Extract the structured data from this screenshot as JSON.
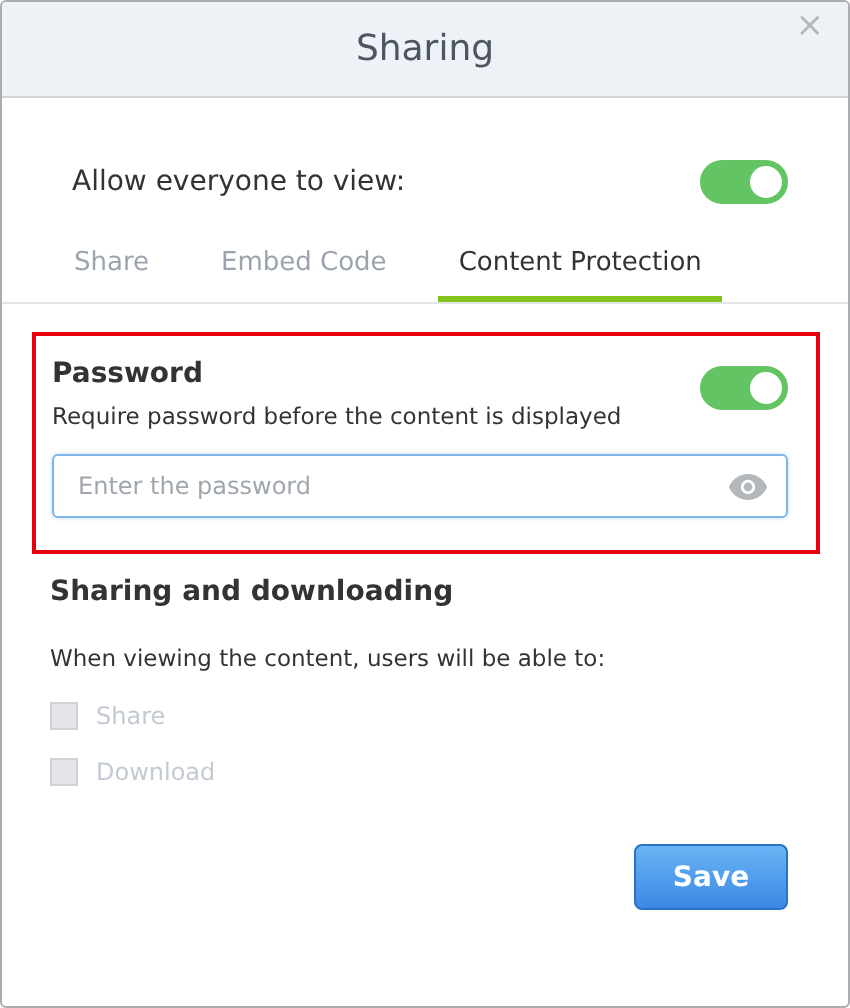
{
  "dialog": {
    "title": "Sharing",
    "close": "×"
  },
  "allow_view": {
    "label": "Allow everyone to view:",
    "on": true
  },
  "tabs": [
    {
      "label": "Share",
      "selected": false
    },
    {
      "label": "Embed Code",
      "selected": false
    },
    {
      "label": "Content Protection",
      "selected": true
    }
  ],
  "password": {
    "highlighted": true,
    "heading": "Password",
    "description": "Require password before the content is displayed",
    "on": true,
    "placeholder": "Enter the password"
  },
  "sharing": {
    "heading": "Sharing and downloading",
    "description": "When viewing the content, users will be able to:",
    "options": [
      {
        "label": "Share",
        "checked": false,
        "disabled": true
      },
      {
        "label": "Download",
        "checked": false,
        "disabled": true
      }
    ]
  },
  "save_button": "Save"
}
